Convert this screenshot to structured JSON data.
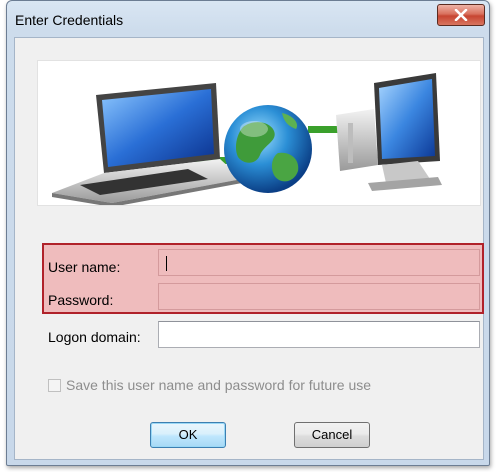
{
  "window": {
    "title": "Enter Credentials"
  },
  "form": {
    "username_label": "User name:",
    "username_value": "",
    "password_label": "Password:",
    "password_value": "",
    "domain_label": "Logon domain:",
    "domain_value": ""
  },
  "save_checkbox": {
    "label": "Save this user name and password for future use",
    "checked": false,
    "disabled": true
  },
  "buttons": {
    "ok": "OK",
    "cancel": "Cancel"
  },
  "banner": {
    "icons": [
      "laptop-icon",
      "globe-icon",
      "desktop-computer-icon"
    ]
  },
  "colors": {
    "highlight_border": "#b0222a",
    "highlight_fill": "#efbcbd",
    "close_button": "#c74531",
    "connector": "#3aa02b"
  }
}
